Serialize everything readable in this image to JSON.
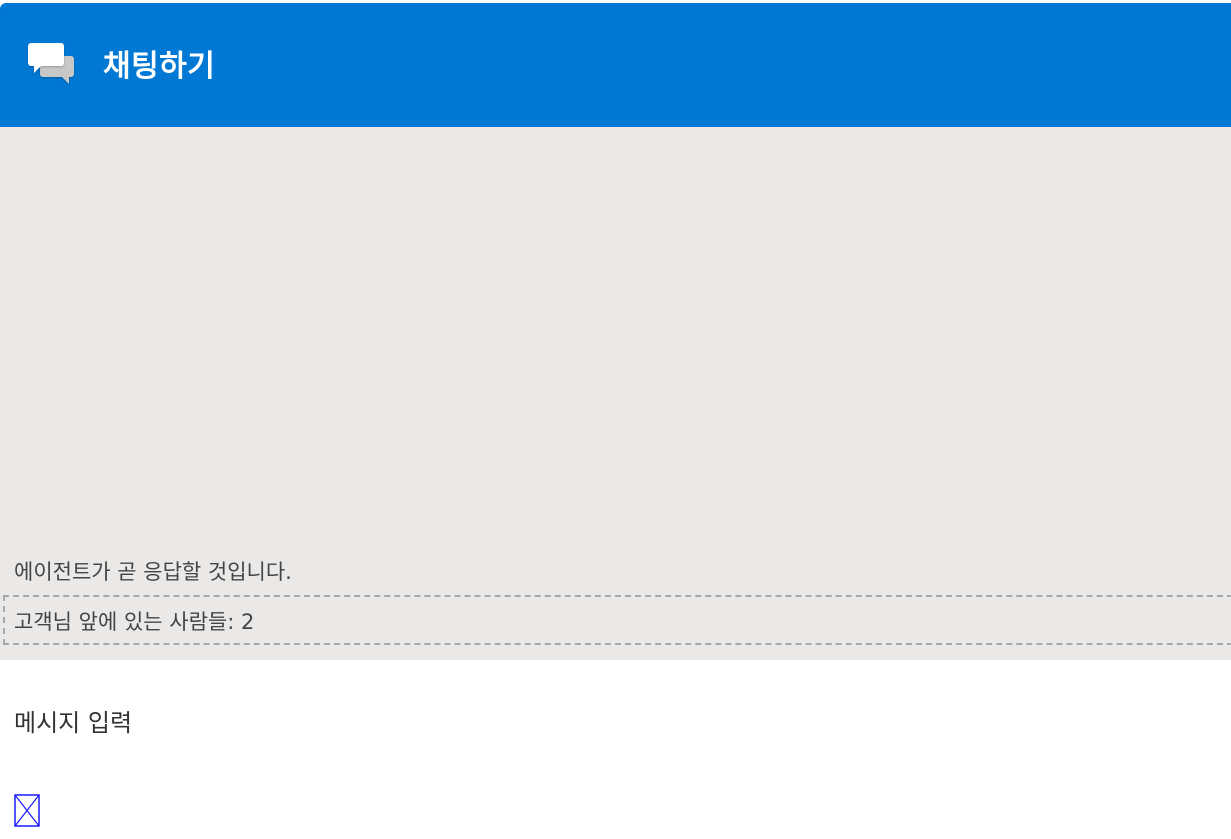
{
  "header": {
    "title": "채팅하기",
    "icon": "chat-bubbles-icon",
    "background_color": "#0078d4"
  },
  "conversation": {
    "background_color": "#ebe9e7",
    "status_message": "에이전트가 곧 응답할 것입니다.",
    "queue_message": "고객님 앞에 있는 사람들: 2"
  },
  "composer": {
    "input_placeholder": "메시지 입력",
    "input_value": "",
    "send_icon": "broken-image-icon"
  }
}
